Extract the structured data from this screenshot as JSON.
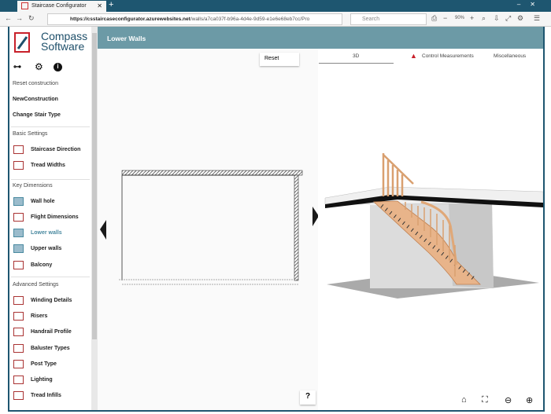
{
  "browser": {
    "tab_title": "Staircase Configurator",
    "url_domain": "https://csstaircaseconfigurator.azurewebsites.net",
    "url_path": "/walls/a7ca037f-b96a-4d4e-9d59-e1e6e68eb7cc/Pro",
    "search_placeholder": "Search",
    "zoom": "90%"
  },
  "logo": {
    "line1": "Compass",
    "line2": "Software"
  },
  "sidebar": {
    "top_items": [
      "Reset construction",
      "NewConstruction",
      "Change Stair Type"
    ],
    "sections": [
      {
        "title": "Basic Settings",
        "items": [
          {
            "label": "Staircase Direction",
            "icon": "staircase-direction-icon"
          },
          {
            "label": "Tread Widths",
            "icon": "tread-widths-icon"
          }
        ]
      },
      {
        "title": "Key Dimensions",
        "items": [
          {
            "label": "Wall hole",
            "icon": "wall-hole-icon"
          },
          {
            "label": "Flight Dimensions",
            "icon": "flight-dimensions-icon"
          },
          {
            "label": "Lower walls",
            "icon": "lower-walls-icon",
            "active": true
          },
          {
            "label": "Upper walls",
            "icon": "upper-walls-icon"
          },
          {
            "label": "Balcony",
            "icon": "balcony-icon"
          }
        ]
      },
      {
        "title": "Advanced Settings",
        "items": [
          {
            "label": "Winding Details",
            "icon": "winding-details-icon"
          },
          {
            "label": "Risers",
            "icon": "risers-icon"
          },
          {
            "label": "Handrail Profile",
            "icon": "handrail-profile-icon"
          },
          {
            "label": "Baluster Types",
            "icon": "baluster-types-icon"
          },
          {
            "label": "Post Type",
            "icon": "post-type-icon"
          },
          {
            "label": "Lighting",
            "icon": "lighting-icon"
          },
          {
            "label": "Tread Infills",
            "icon": "tread-infills-icon"
          }
        ]
      }
    ]
  },
  "header": {
    "title": "Lower Walls"
  },
  "editor": {
    "reset_label": "Reset"
  },
  "view_tabs": {
    "tab_3d": "3D",
    "control": "Control Measurements",
    "misc": "Miscellaneous"
  },
  "help_label": "?",
  "colors": {
    "accent": "#6c9aa6",
    "chrome": "#1e5670",
    "active_item": "#4a8aa0",
    "logo_red": "#c8202a"
  }
}
